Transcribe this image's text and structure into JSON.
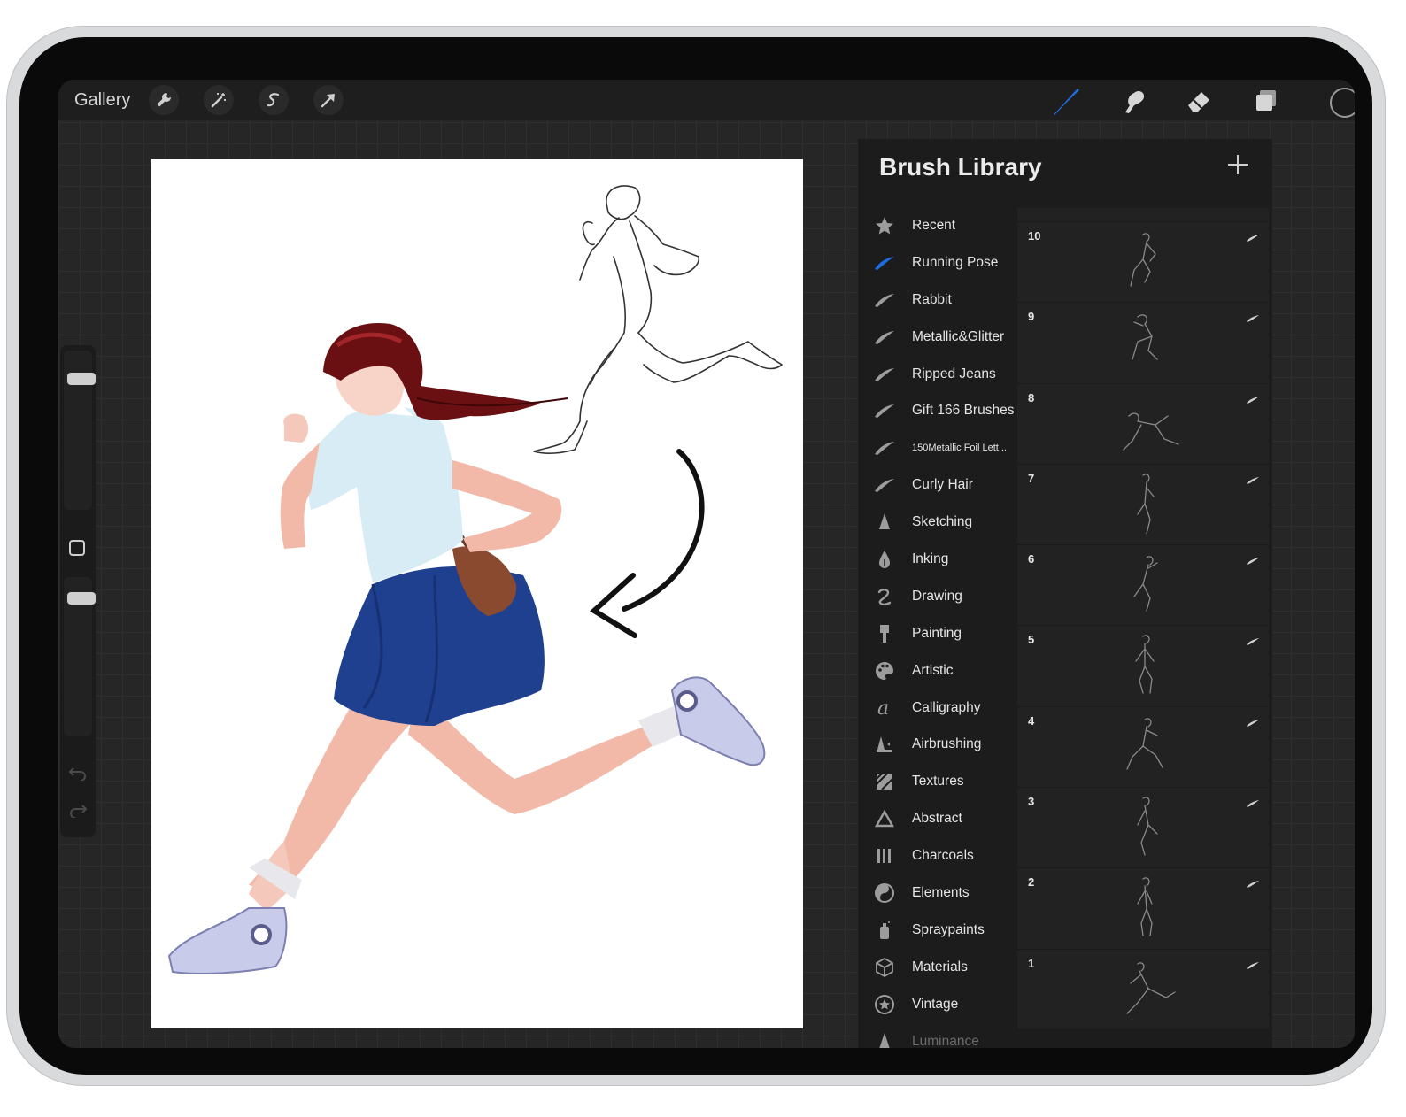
{
  "toolbar": {
    "gallery_label": "Gallery",
    "left_tools": [
      "wrench-icon",
      "magic-wand-icon",
      "selection-s-icon",
      "transform-arrow-icon"
    ],
    "right_tools": [
      "brush-icon",
      "smudge-icon",
      "eraser-icon",
      "layers-icon"
    ],
    "active_tool": "brush-icon",
    "current_color": "#1a1a1a",
    "accent_color": "#1e6be0"
  },
  "brush_library": {
    "title": "Brush Library",
    "add_icon": "plus-icon",
    "selected_set": "Running Pose",
    "sets": [
      {
        "label": "Recent",
        "icon": "star-icon"
      },
      {
        "label": "Running Pose",
        "icon": "brush-stroke-icon"
      },
      {
        "label": "Rabbit",
        "icon": "brush-stroke-icon"
      },
      {
        "label": "Metallic&Glitter",
        "icon": "brush-stroke-icon"
      },
      {
        "label": "Ripped Jeans",
        "icon": "brush-stroke-icon"
      },
      {
        "label": "Gift 166 Brushes",
        "icon": "brush-stroke-icon"
      },
      {
        "label": "150Metallic Foil Lett...",
        "icon": "brush-stroke-icon"
      },
      {
        "label": "Curly Hair",
        "icon": "brush-stroke-icon"
      },
      {
        "label": "Sketching",
        "icon": "pencil-tip-icon"
      },
      {
        "label": "Inking",
        "icon": "ink-drop-icon"
      },
      {
        "label": "Drawing",
        "icon": "squiggle-icon"
      },
      {
        "label": "Painting",
        "icon": "paint-brush-icon"
      },
      {
        "label": "Artistic",
        "icon": "palette-icon"
      },
      {
        "label": "Calligraphy",
        "icon": "calligraphy-a-icon"
      },
      {
        "label": "Airbrushing",
        "icon": "airbrush-icon"
      },
      {
        "label": "Textures",
        "icon": "texture-icon"
      },
      {
        "label": "Abstract",
        "icon": "triangle-icon"
      },
      {
        "label": "Charcoals",
        "icon": "charcoal-bars-icon"
      },
      {
        "label": "Elements",
        "icon": "yin-yang-icon"
      },
      {
        "label": "Spraypaints",
        "icon": "spray-can-icon"
      },
      {
        "label": "Materials",
        "icon": "cube-icon"
      },
      {
        "label": "Vintage",
        "icon": "star-badge-icon"
      },
      {
        "label": "Luminance",
        "icon": "pencil-tip-icon"
      }
    ],
    "brushes": [
      {
        "number": "10"
      },
      {
        "number": "9"
      },
      {
        "number": "8"
      },
      {
        "number": "7"
      },
      {
        "number": "6"
      },
      {
        "number": "5"
      },
      {
        "number": "4"
      },
      {
        "number": "3"
      },
      {
        "number": "2"
      },
      {
        "number": "1"
      }
    ]
  },
  "sidebar": {
    "brush_size_level": 0.85,
    "opacity_level": 0.9,
    "undo_icon": "undo-icon",
    "redo_icon": "redo-icon",
    "modify_button_icon": "square-icon"
  }
}
